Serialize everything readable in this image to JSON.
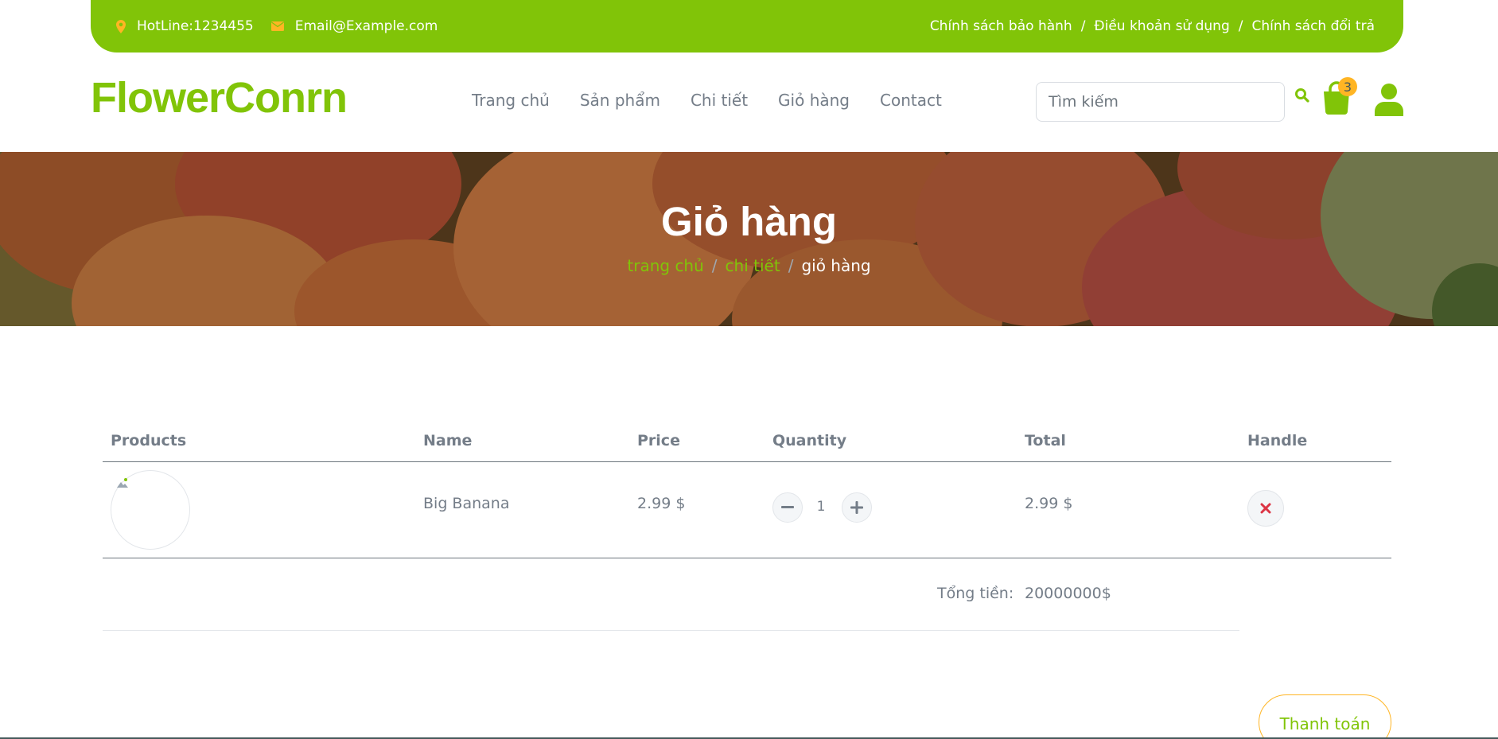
{
  "topbar": {
    "hotline": "HotLine:1234455",
    "email": "Email@Example.com",
    "links": [
      "Chính sách bảo hành",
      "Điều khoản sử dụng",
      "Chính sách đổi trả"
    ],
    "separator": "/"
  },
  "header": {
    "logo": "FlowerConrn",
    "nav": [
      "Trang chủ",
      "Sản phẩm",
      "Chi tiết",
      "Giỏ hàng",
      "Contact"
    ],
    "search_placeholder": "Tìm kiếm",
    "cart_count": "3"
  },
  "hero": {
    "title": "Giỏ hàng",
    "breadcrumb": [
      "trang chủ",
      "chi tiết",
      "giỏ hàng"
    ],
    "separator": "/"
  },
  "cart": {
    "columns": [
      "Products",
      "Name",
      "Price",
      "Quantity",
      "Total",
      "Handle"
    ],
    "rows": [
      {
        "name": "Big Banana",
        "price": "2.99 $",
        "quantity": "1",
        "total": "2.99 $"
      }
    ],
    "total_label": "Tổng tiền:",
    "total_value": "20000000$",
    "checkout_label": "Thanh toán"
  },
  "colors": {
    "primary": "#81c408",
    "secondary": "#ffb524",
    "text": "#747d88",
    "danger": "#dc3545"
  },
  "icons": {
    "hotline": "map-marker-icon",
    "email": "envelope-icon",
    "search": "search-icon",
    "cart": "shopping-bag-icon",
    "user": "user-icon",
    "minus": "minus-icon",
    "plus": "plus-icon",
    "delete": "times-icon"
  }
}
